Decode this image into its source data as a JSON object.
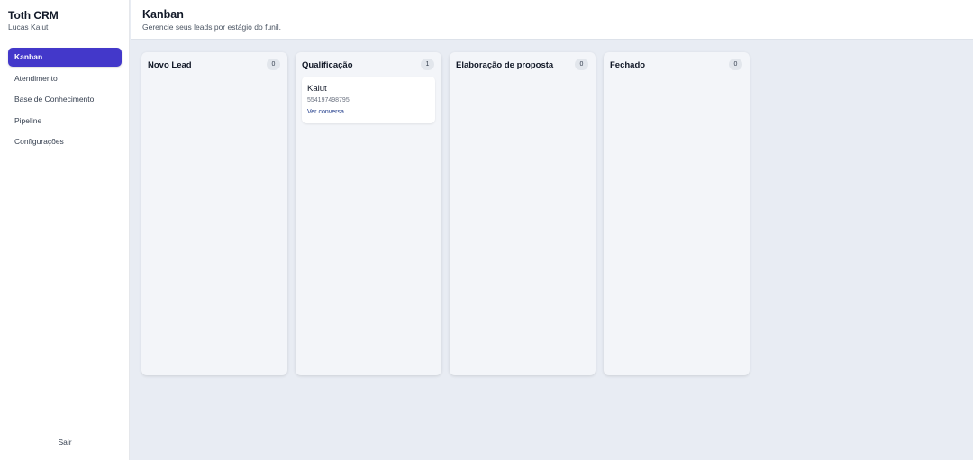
{
  "sidebar": {
    "brand": "Toth CRM",
    "user": "Lucas Kaiut",
    "items": [
      {
        "label": "Kanban"
      },
      {
        "label": "Atendimento"
      },
      {
        "label": "Base de Conhecimento"
      },
      {
        "label": "Pipeline"
      },
      {
        "label": "Configurações"
      }
    ],
    "logout_label": "Sair"
  },
  "header": {
    "title": "Kanban",
    "subtitle": "Gerencie seus leads por estágio do funil."
  },
  "columns": [
    {
      "title": "Novo Lead",
      "count": "0"
    },
    {
      "title": "Qualificação",
      "count": "1",
      "cards": [
        {
          "name": "Kaiut",
          "phone": "554197498795",
          "link": "Ver conversa"
        }
      ]
    },
    {
      "title": "Elaboração de proposta",
      "count": "0"
    },
    {
      "title": "Fechado",
      "count": "0"
    }
  ],
  "colors": {
    "accent": "#4338ca",
    "background": "#e8ecf3",
    "column_bg": "#f3f5f9",
    "link": "#1e3a8a"
  }
}
